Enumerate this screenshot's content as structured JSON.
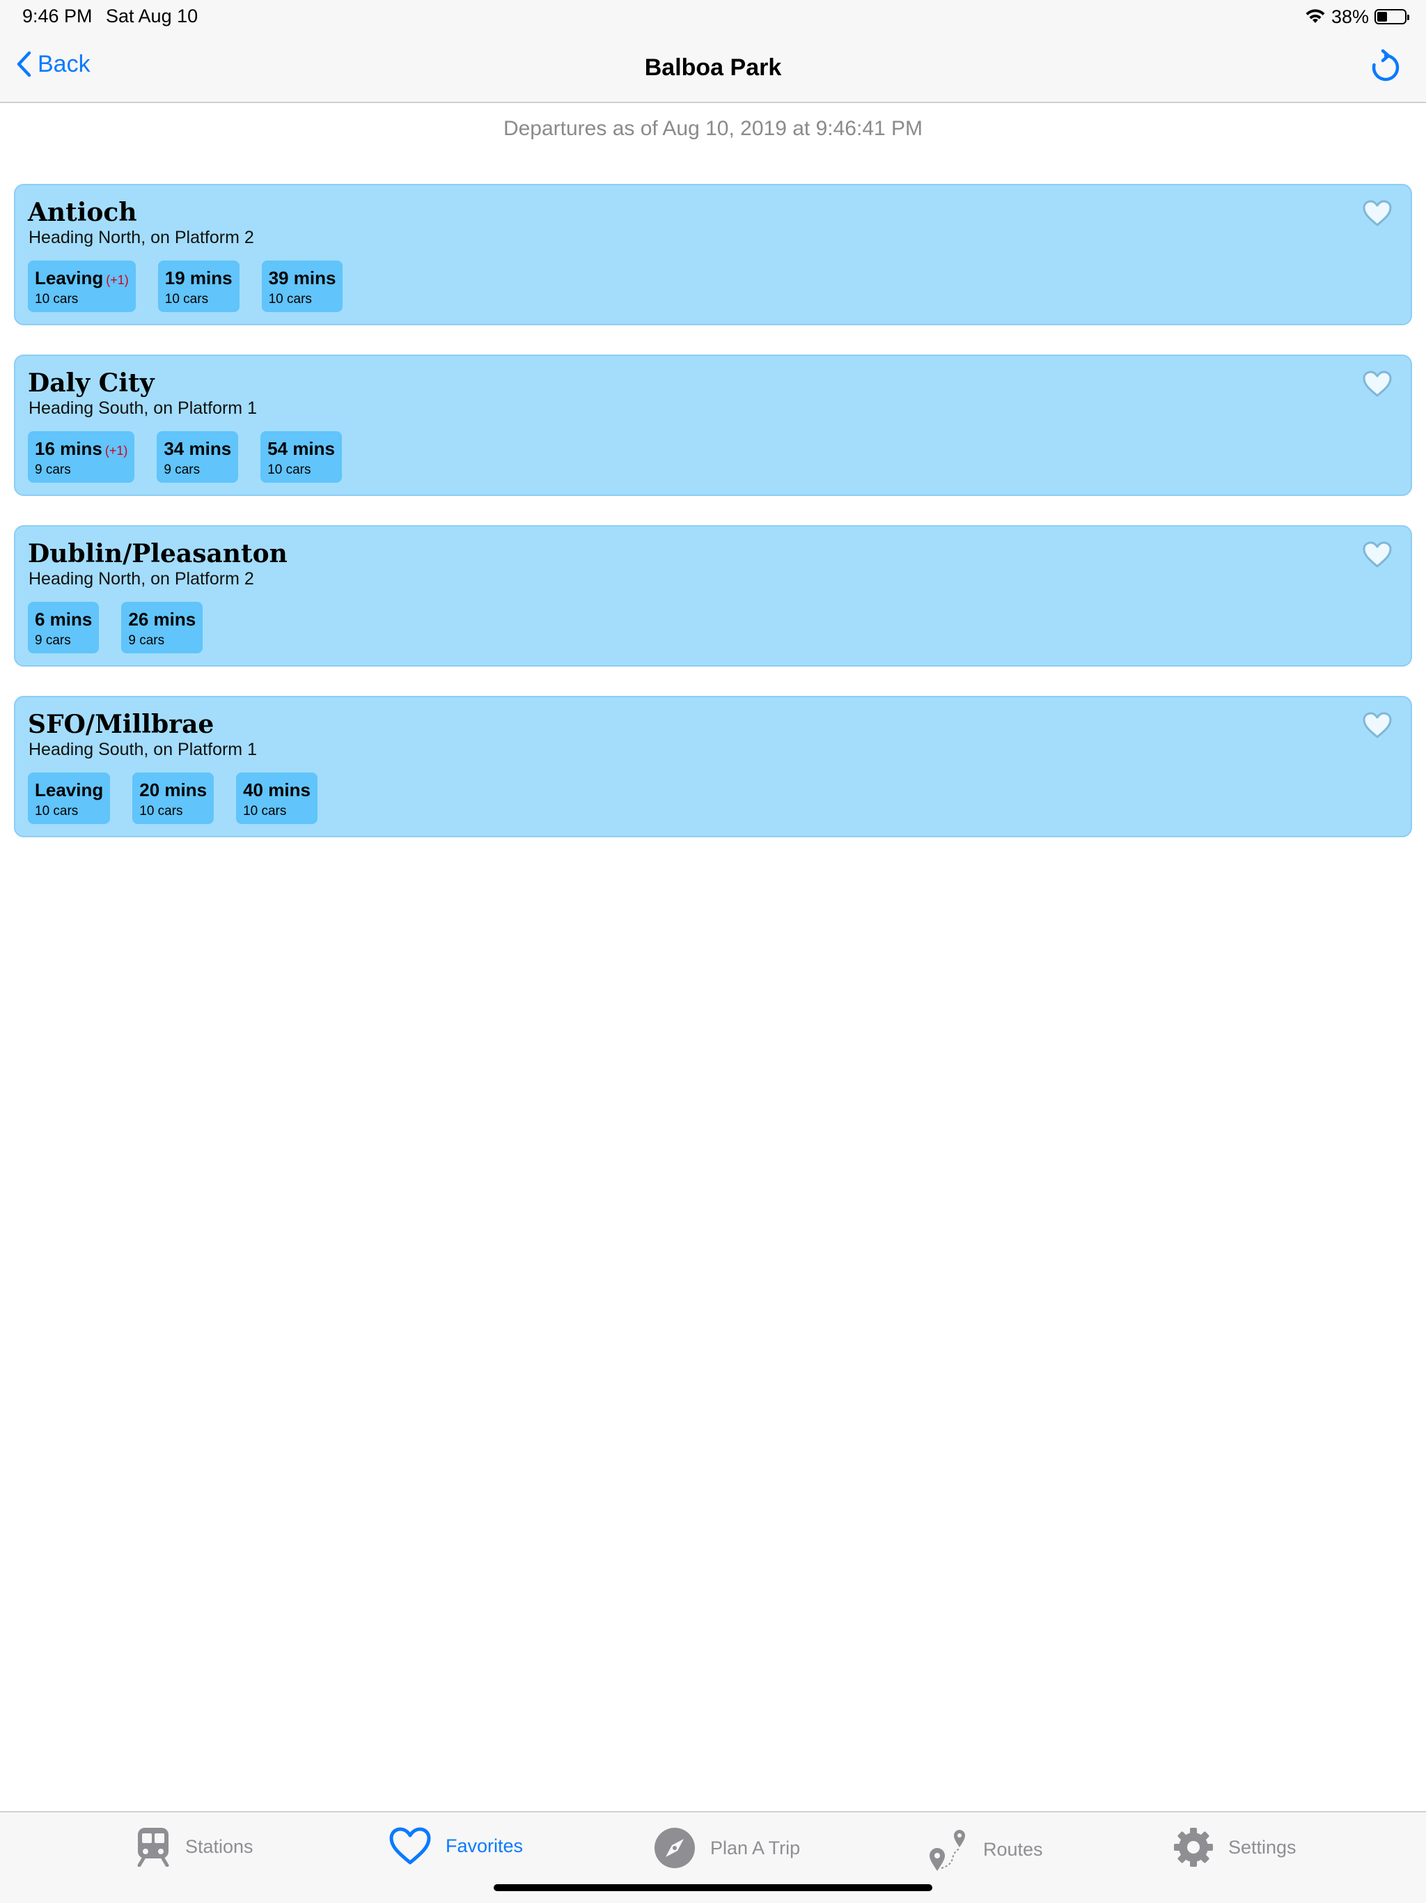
{
  "status_bar": {
    "time": "9:46 PM",
    "date": "Sat Aug 10",
    "battery_percent_label": "38%",
    "battery_level": 0.38
  },
  "nav": {
    "back_label": "Back",
    "title": "Balboa Park",
    "refresh_icon": "refresh-icon"
  },
  "departures_header": "Departures as of Aug 10, 2019 at 9:46:41 PM",
  "colors": {
    "accent": "#0a7aff",
    "card_background": "#a3ddfb",
    "chip_background": "#61c4fa",
    "delay_text": "#d0021b"
  },
  "destinations": [
    {
      "name": "Antioch",
      "subtitle": "Heading North, on Platform 2",
      "departures": [
        {
          "time": "Leaving",
          "delay": "(+1)",
          "cars": "10 cars"
        },
        {
          "time": "19 mins",
          "delay": "",
          "cars": "10 cars"
        },
        {
          "time": "39 mins",
          "delay": "",
          "cars": "10 cars"
        }
      ]
    },
    {
      "name": "Daly City",
      "subtitle": "Heading South, on Platform 1",
      "departures": [
        {
          "time": "16 mins",
          "delay": "(+1)",
          "cars": "9 cars"
        },
        {
          "time": "34 mins",
          "delay": "",
          "cars": "9 cars"
        },
        {
          "time": "54 mins",
          "delay": "",
          "cars": "10 cars"
        }
      ]
    },
    {
      "name": "Dublin/Pleasanton",
      "subtitle": "Heading North, on Platform 2",
      "departures": [
        {
          "time": "6 mins",
          "delay": "",
          "cars": "9 cars"
        },
        {
          "time": "26 mins",
          "delay": "",
          "cars": "9 cars"
        }
      ]
    },
    {
      "name": "SFO/Millbrae",
      "subtitle": "Heading South, on Platform 1",
      "departures": [
        {
          "time": "Leaving",
          "delay": "",
          "cars": "10 cars"
        },
        {
          "time": "20 mins",
          "delay": "",
          "cars": "10 cars"
        },
        {
          "time": "40 mins",
          "delay": "",
          "cars": "10 cars"
        }
      ]
    }
  ],
  "tabs": [
    {
      "label": "Stations",
      "icon": "train-icon",
      "active": false
    },
    {
      "label": "Favorites",
      "icon": "heart-icon",
      "active": true
    },
    {
      "label": "Plan A Trip",
      "icon": "compass-icon",
      "active": false
    },
    {
      "label": "Routes",
      "icon": "route-pins-icon",
      "active": false
    },
    {
      "label": "Settings",
      "icon": "gear-icon",
      "active": false
    }
  ]
}
